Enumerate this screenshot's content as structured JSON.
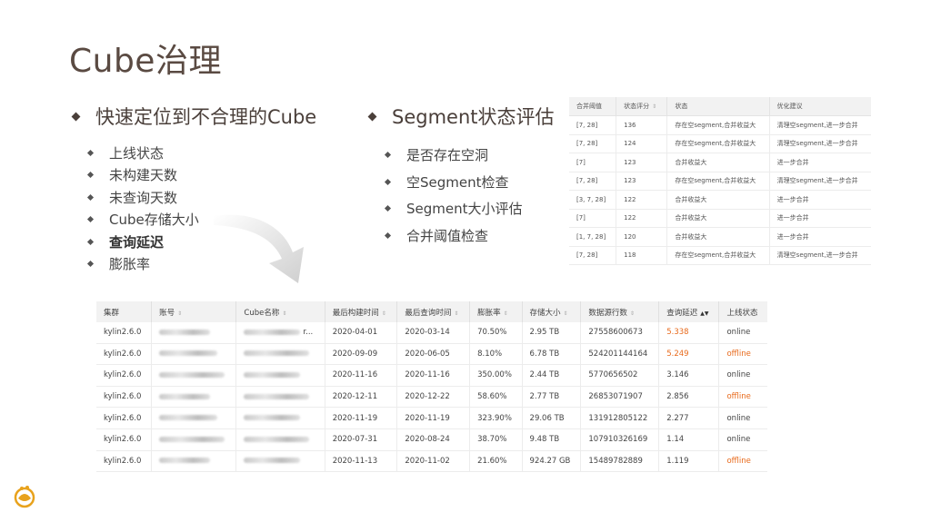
{
  "title": "Cube治理",
  "left_section": {
    "heading": "快速定位到不合理的Cube",
    "items": [
      {
        "label": "上线状态",
        "bold": false
      },
      {
        "label": "未构建天数",
        "bold": false
      },
      {
        "label": "未查询天数",
        "bold": false
      },
      {
        "label": "Cube存储大小",
        "bold": false
      },
      {
        "label": "查询延迟",
        "bold": true
      },
      {
        "label": "膨胀率",
        "bold": false
      }
    ]
  },
  "middle_section": {
    "heading": "Segment状态评估",
    "items": [
      {
        "label": "是否存在空洞"
      },
      {
        "label": "空Segment检查"
      },
      {
        "label": "Segment大小评估"
      },
      {
        "label": "合并阈值检查"
      }
    ]
  },
  "segment_table": {
    "headers": [
      "合并阈值",
      "状态评分",
      "状态",
      "优化建议"
    ],
    "rows": [
      [
        "[7, 28]",
        "136",
        "存在空segment,合并收益大",
        "清理空segment,进一步合并"
      ],
      [
        "[7, 28]",
        "124",
        "存在空segment,合并收益大",
        "清理空segment,进一步合并"
      ],
      [
        "[7]",
        "123",
        "合并收益大",
        "进一步合并"
      ],
      [
        "[7, 28]",
        "123",
        "存在空segment,合并收益大",
        "清理空segment,进一步合并"
      ],
      [
        "[3, 7, 28]",
        "122",
        "合并收益大",
        "进一步合并"
      ],
      [
        "[7]",
        "122",
        "合并收益大",
        "进一步合并"
      ],
      [
        "[1, 7, 28]",
        "120",
        "合并收益大",
        "进一步合并"
      ],
      [
        "[7, 28]",
        "118",
        "存在空segment,合并收益大",
        "清理空segment,进一步合并"
      ]
    ]
  },
  "cube_table": {
    "headers": [
      "集群",
      "账号",
      "Cube名称",
      "最后构建时间",
      "最后查询时间",
      "膨胀率",
      "存储大小",
      "数据源行数",
      "查询延迟",
      "上线状态"
    ],
    "rows": [
      {
        "cluster": "kylin2.6.0",
        "account": "",
        "cube": "",
        "name_tail": "r...",
        "build": "2020-04-01",
        "query": "2020-03-14",
        "rate": "70.50%",
        "size": "2.95 TB",
        "rows": "27558600673",
        "latency": "5.338",
        "latency_hi": true,
        "status": "online",
        "status_hi": false
      },
      {
        "cluster": "kylin2.6.0",
        "account": "",
        "cube": "",
        "name_tail": "",
        "build": "2020-09-09",
        "query": "2020-06-05",
        "rate": "8.10%",
        "size": "6.78 TB",
        "rows": "524201144164",
        "latency": "5.249",
        "latency_hi": true,
        "status": "offline",
        "status_hi": true
      },
      {
        "cluster": "kylin2.6.0",
        "account": "",
        "cube": "",
        "name_tail": "",
        "build": "2020-11-16",
        "query": "2020-11-16",
        "rate": "350.00%",
        "size": "2.44 TB",
        "rows": "5770656502",
        "latency": "3.146",
        "latency_hi": false,
        "status": "online",
        "status_hi": false
      },
      {
        "cluster": "kylin2.6.0",
        "account": "",
        "cube": "",
        "name_tail": "",
        "build": "2020-12-11",
        "query": "2020-12-22",
        "rate": "58.60%",
        "size": "2.77 TB",
        "rows": "26853071907",
        "latency": "2.856",
        "latency_hi": false,
        "status": "offline",
        "status_hi": true
      },
      {
        "cluster": "kylin2.6.0",
        "account": "",
        "cube": "",
        "name_tail": "",
        "build": "2020-11-19",
        "query": "2020-11-19",
        "rate": "323.90%",
        "size": "29.06 TB",
        "rows": "131912805122",
        "latency": "2.277",
        "latency_hi": false,
        "status": "online",
        "status_hi": false
      },
      {
        "cluster": "kylin2.6.0",
        "account": "",
        "cube": "",
        "name_tail": "",
        "build": "2020-07-31",
        "query": "2020-08-24",
        "rate": "38.70%",
        "size": "9.48 TB",
        "rows": "107910326169",
        "latency": "1.14",
        "latency_hi": false,
        "status": "online",
        "status_hi": false
      },
      {
        "cluster": "kylin2.6.0",
        "account": "",
        "cube": "",
        "name_tail": "",
        "build": "2020-11-13",
        "query": "2020-11-02",
        "rate": "21.60%",
        "size": "924.27 GB",
        "rows": "15489782889",
        "latency": "1.119",
        "latency_hi": false,
        "status": "offline",
        "status_hi": true
      }
    ]
  },
  "colors": {
    "accent": "#e86a1c",
    "title": "#5a4a42",
    "header_bg": "#f2f2f2"
  },
  "icons": {
    "sort": "sort-icon",
    "arrow": "curved-arrow-icon",
    "logo": "logo-icon"
  }
}
